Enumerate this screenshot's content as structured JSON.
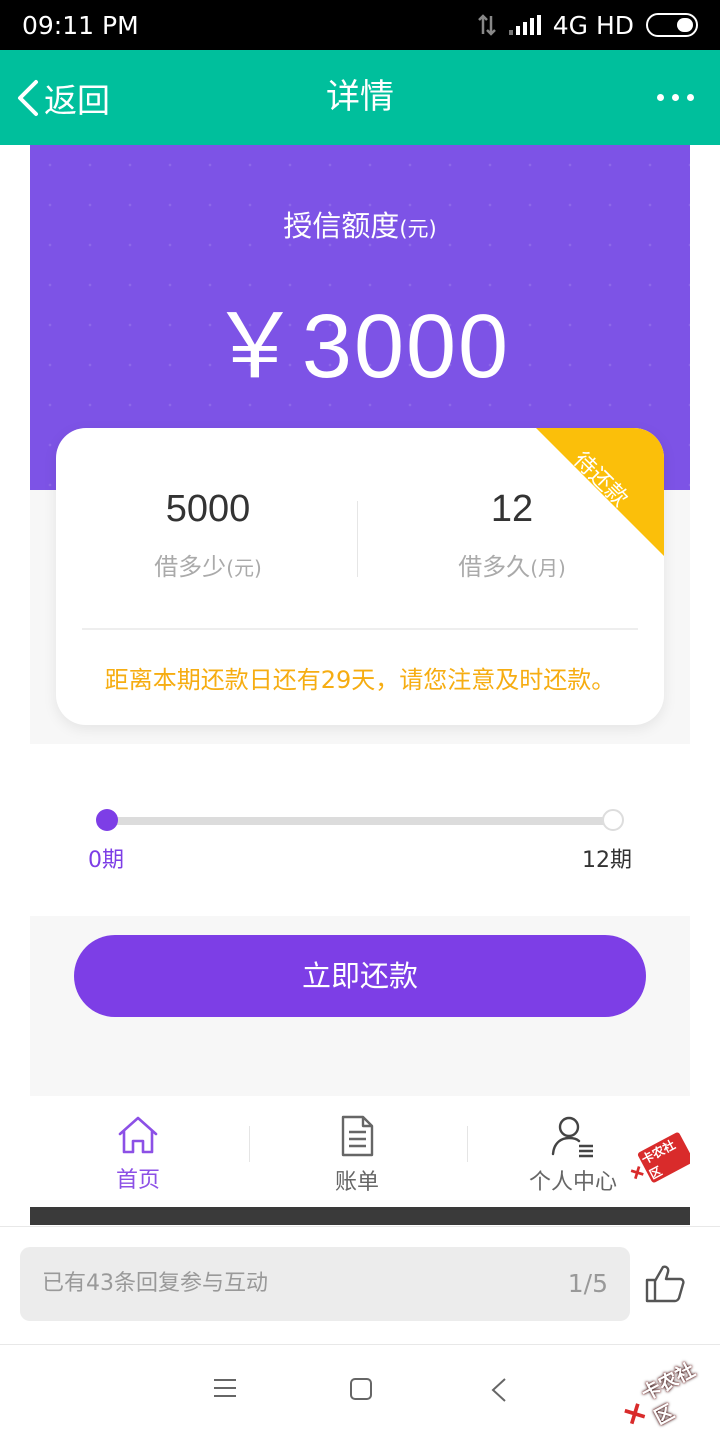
{
  "status_bar": {
    "time": "09:11  PM",
    "network": "4G HD"
  },
  "nav": {
    "back_label": "返回",
    "title": "详情"
  },
  "hero": {
    "label": "授信额度",
    "label_unit": "(元)",
    "amount": "￥3000"
  },
  "card": {
    "ribbon": "待还款",
    "stats": [
      {
        "value": "5000",
        "label": "借多少",
        "unit": "(元)"
      },
      {
        "value": "12",
        "label": "借多久",
        "unit": "(月)"
      }
    ],
    "notice": "距离本期还款日还有29天，请您注意及时还款。"
  },
  "progress": {
    "start_label": "0期",
    "end_label": "12期",
    "paid_periods": 0,
    "total_periods": 12
  },
  "repay_button": "立即还款",
  "tabs": [
    {
      "label": "首页",
      "icon": "home-icon",
      "active": true
    },
    {
      "label": "账单",
      "icon": "bill-icon",
      "active": false
    },
    {
      "label": "个人中心",
      "icon": "user-center-icon",
      "active": false
    }
  ],
  "watermark": "卡农社区",
  "reply": {
    "placeholder": "已有43条回复参与互动",
    "page": "1/5"
  },
  "colors": {
    "nav_green": "#00bf9c",
    "purple": "#7d3ee6",
    "ribbon_yellow": "#fbbf0a",
    "notice_orange": "#f6ad12"
  }
}
